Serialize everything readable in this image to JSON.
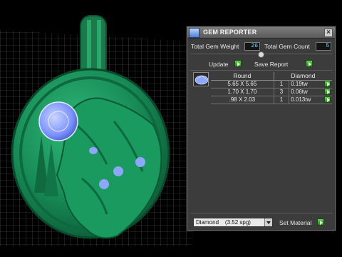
{
  "panel": {
    "title": "GEM REPORTER",
    "close_icon": "close-icon",
    "total_gem_weight_label": "Total Gem Weight",
    "total_gem_weight_value": "26",
    "total_gem_count_label": "Total Gem Count",
    "total_gem_count_value": "5",
    "update_label": "Update",
    "save_report_label": "Save Report",
    "table": {
      "headers": [
        "Round",
        "Diamond"
      ],
      "rows": [
        {
          "size": "5.65 X 5.65",
          "count": "1",
          "weight": "0.19tw"
        },
        {
          "size": "1.70 X 1.70",
          "count": "3",
          "weight": "0.06tw"
        },
        {
          "size": ".98 X 2.03",
          "count": "1",
          "weight": "0.013tw"
        }
      ]
    },
    "material_selected": "Diamond    (3.52 spg)",
    "set_material_label": "Set Material"
  },
  "colors": {
    "model": "#1f8a5a",
    "gem": "#8aa4ff",
    "panel": "#3c3c3c",
    "go_button": "#3fb02c"
  }
}
